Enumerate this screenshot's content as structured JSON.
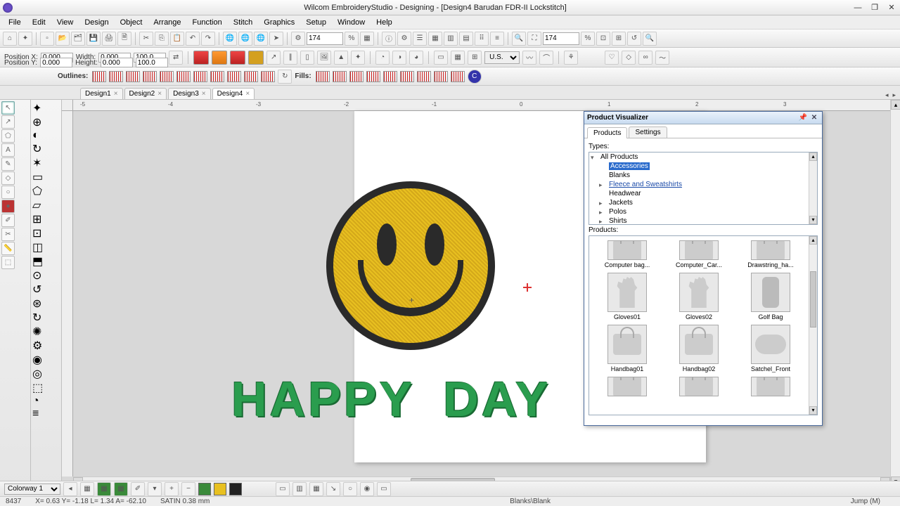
{
  "title": "Wilcom EmbroideryStudio - Designing - [Design4         Barudan FDR-II Lockstitch]",
  "menus": [
    "File",
    "Edit",
    "View",
    "Design",
    "Object",
    "Arrange",
    "Function",
    "Stitch",
    "Graphics",
    "Setup",
    "Window",
    "Help"
  ],
  "zoom1": "174",
  "zoom2": "174",
  "position": {
    "x_label": "Position X:",
    "y_label": "Position Y:",
    "x": "0.000",
    "y": "0.000",
    "w_label": "Width:",
    "h_label": "Height:",
    "w": "0.000",
    "h": "0.000",
    "wp": "100.0",
    "hp": "100.0",
    "units": "U.S."
  },
  "outlines_label": "Outlines:",
  "fills_label": "Fills:",
  "tabs": [
    {
      "name": "Design1",
      "active": false
    },
    {
      "name": "Design2",
      "active": false
    },
    {
      "name": "Design3",
      "active": false
    },
    {
      "name": "Design4",
      "active": true
    }
  ],
  "ruler_ticks": [
    "-5",
    "-4",
    "-3",
    "-2",
    "-1",
    "0",
    "1",
    "2",
    "3"
  ],
  "happy_text_1": "HAPPY",
  "happy_text_2": "DAY",
  "pv": {
    "title": "Product Visualizer",
    "tab_products": "Products",
    "tab_settings": "Settings",
    "types_label": "Types:",
    "products_label": "Products:",
    "tree": {
      "root": "All Products",
      "items": [
        {
          "label": "Accessories",
          "selected": true
        },
        {
          "label": "Blanks"
        },
        {
          "label": "Fleece and Sweatshirts",
          "link": true,
          "expandable": true
        },
        {
          "label": "Headwear"
        },
        {
          "label": "Jackets",
          "expandable": true
        },
        {
          "label": "Polos",
          "expandable": true
        },
        {
          "label": "Shirts",
          "expandable": true
        }
      ]
    },
    "products": [
      {
        "name": "Computer bag...",
        "kind": "bag",
        "half": true
      },
      {
        "name": "Computer_Car...",
        "kind": "bag",
        "half": true
      },
      {
        "name": "Drawstring_ha...",
        "kind": "bag",
        "half": true
      },
      {
        "name": "Gloves01",
        "kind": "glove"
      },
      {
        "name": "Gloves02",
        "kind": "glove"
      },
      {
        "name": "Golf Bag",
        "kind": "golfbag"
      },
      {
        "name": "Handbag01",
        "kind": "bag"
      },
      {
        "name": "Handbag02",
        "kind": "bag"
      },
      {
        "name": "Satchel_Front",
        "kind": "satchel"
      },
      {
        "name": "",
        "kind": "bag",
        "half_bottom": true
      },
      {
        "name": "",
        "kind": "bag",
        "half_bottom": true
      },
      {
        "name": "",
        "kind": "bag",
        "half_bottom": true
      }
    ]
  },
  "colorbar": {
    "colorway": "Colorway 1"
  },
  "status": {
    "stitches": "8437",
    "coords": "X=    0.63 Y=   -1.18 L=     1.34 A=  -62.10",
    "stitch_type": "SATIN  0.38 mm",
    "fabric": "Blanks\\Blank",
    "mode": "Jump (M)"
  }
}
